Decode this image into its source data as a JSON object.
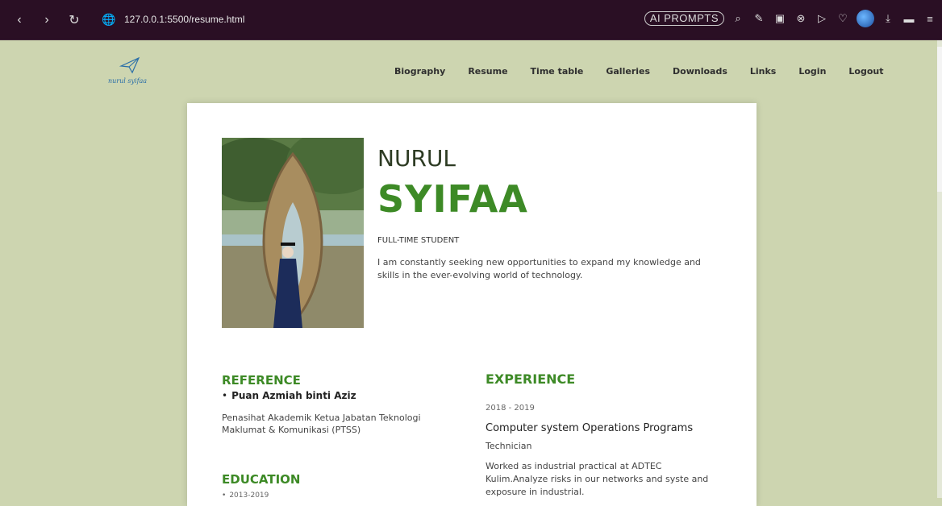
{
  "browser": {
    "url": "127.0.0.1:5500/resume.html",
    "ai_prompts_label": "AI PROMPTS"
  },
  "site": {
    "brand": "nurul syifaa",
    "nav": [
      "Biography",
      "Resume",
      "Time table",
      "Galleries",
      "Downloads",
      "Links",
      "Login",
      "Logout"
    ]
  },
  "profile": {
    "first_name": "NURUL",
    "last_name": "SYIFAA",
    "role": "FULL-TIME STUDENT",
    "bio": "I am constantly seeking new opportunities to expand my knowledge and skills in the ever-evolving world of technology."
  },
  "reference": {
    "title": "REFERENCE",
    "name": "Puan Azmiah binti Aziz",
    "description": "Penasihat Akademik Ketua Jabatan Teknologi Maklumat & Komunikasi (PTSS)"
  },
  "education": {
    "title": "EDUCATION",
    "first_date": "2013-2019"
  },
  "experience": {
    "title": "EXPERIENCE",
    "date": "2018 - 2019",
    "job": "Computer system Operations Programs",
    "role": "Technician",
    "description": "Worked as industrial practical at ADTEC Kulim.Analyze risks in our networks and syste and exposure in industrial."
  },
  "colors": {
    "page_bg": "#cdd5b0",
    "accent_green": "#3d8a26",
    "chrome_bg": "#2a0f24"
  }
}
